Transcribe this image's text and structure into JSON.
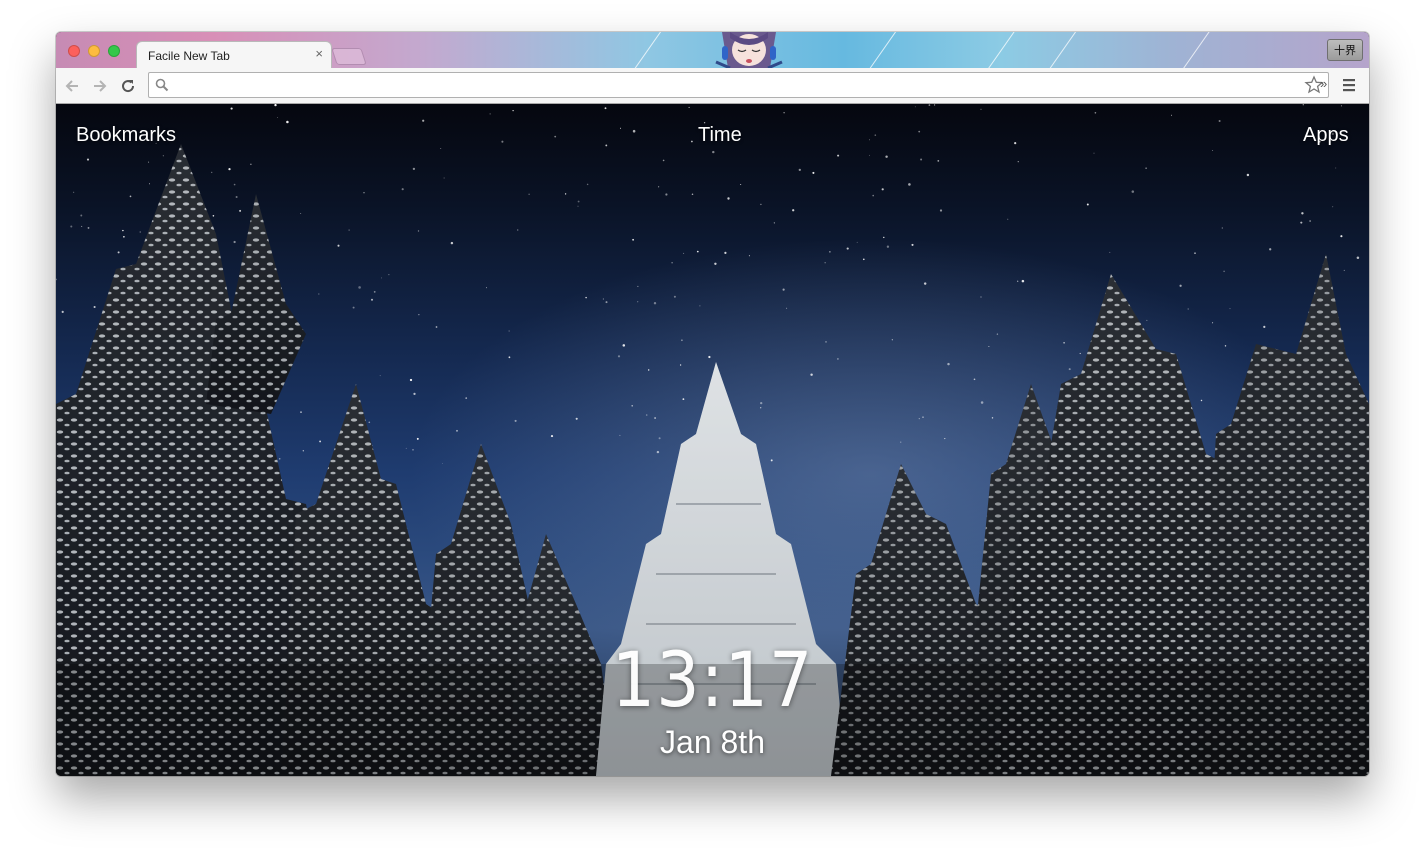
{
  "browser": {
    "tab": {
      "title": "Facile New Tab",
      "close_glyph": "×"
    },
    "profile_button_label": "十界",
    "omnibox": {
      "value": "",
      "placeholder": ""
    },
    "extensions_overflow_glyph": "»",
    "icons": {
      "back": "back-arrow-icon",
      "forward": "forward-arrow-icon",
      "reload": "reload-icon",
      "search": "search-icon",
      "bookmark_star": "star-icon",
      "menu": "hamburger-menu-icon"
    }
  },
  "page": {
    "nav": {
      "bookmarks_label": "Bookmarks",
      "time_label": "Time",
      "apps_label": "Apps"
    },
    "clock": {
      "time": "13:17",
      "date": "Jan 8th"
    },
    "background": {
      "sky_top": "#05070f",
      "sky_mid": "#1f3c70",
      "tree_dark": "#1a1d22",
      "snow": "#e8ecef"
    }
  },
  "colors": {
    "close": "#fc605c",
    "minimize": "#fdbc40",
    "maximize": "#34c84a"
  }
}
